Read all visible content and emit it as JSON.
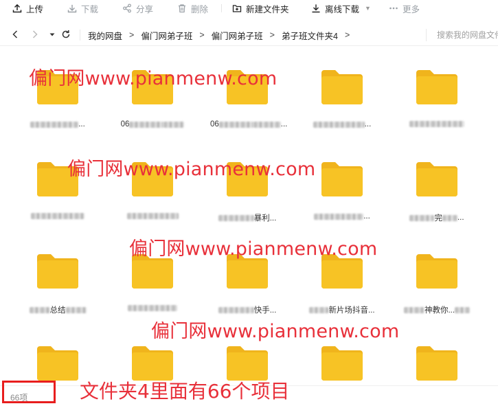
{
  "toolbar": {
    "upload": "上传",
    "download": "下载",
    "share": "分享",
    "delete": "删除",
    "new_folder": "新建文件夹",
    "offline_download": "离线下载",
    "more": "更多"
  },
  "breadcrumb": [
    "我的网盘",
    "偏门网弟子班",
    "偏门网弟子班",
    "弟子班文件夹4"
  ],
  "breadcrumb_sep": ">",
  "search": {
    "placeholder": "搜索我的网盘文件"
  },
  "files": [
    {
      "prefix": "",
      "text": "",
      "suffix": "..."
    },
    {
      "prefix": "06",
      "text": "",
      "suffix": ""
    },
    {
      "prefix": "06",
      "text": "",
      "suffix": "..."
    },
    {
      "prefix": "",
      "text": "",
      "suffix": "..."
    },
    {
      "prefix": "",
      "text": "",
      "suffix": ""
    },
    {
      "prefix": "",
      "text": "",
      "suffix": ""
    },
    {
      "prefix": "",
      "text": "",
      "suffix": ""
    },
    {
      "prefix": "",
      "text": "暴利...",
      "suffix": ""
    },
    {
      "prefix": "",
      "text": "",
      "suffix": "..."
    },
    {
      "prefix": "",
      "text": "完",
      "suffix": "..."
    },
    {
      "prefix": "",
      "text": "总结",
      "suffix": ""
    },
    {
      "prefix": "",
      "text": "",
      "suffix": ""
    },
    {
      "prefix": "",
      "text": "快手...",
      "suffix": ""
    },
    {
      "prefix": "",
      "text": "新片场抖音...",
      "suffix": ""
    },
    {
      "prefix": "",
      "text": "神教你...",
      "suffix": ""
    },
    {
      "prefix": "",
      "text": "",
      "suffix": ""
    },
    {
      "prefix": "",
      "text": "",
      "suffix": ""
    },
    {
      "prefix": "",
      "text": "",
      "suffix": ""
    },
    {
      "prefix": "",
      "text": "",
      "suffix": ""
    },
    {
      "prefix": "",
      "text": "",
      "suffix": ""
    }
  ],
  "watermark": "偏门网www.pianmenw.com",
  "status": {
    "count": "66项"
  },
  "annotation": "文件夹4里面有66个项目",
  "colors": {
    "folder": "#F7C325",
    "folder_tab": "#F0B41C",
    "watermark": "#E8303A",
    "highlight_box": "#E81D1D"
  }
}
